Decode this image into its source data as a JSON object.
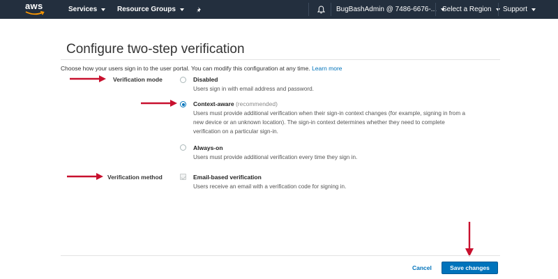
{
  "topnav": {
    "logo_text": "aws",
    "services": "Services",
    "resource_groups": "Resource Groups",
    "account": "BugBashAdmin @ 7486-6676-...",
    "region": "Select a Region",
    "support": "Support"
  },
  "page": {
    "title": "Configure two-step verification",
    "intro": "Choose how your users sign in to the user portal. You can modify this configuration at any time.",
    "learn_more": "Learn more"
  },
  "verification_mode": {
    "label": "Verification mode",
    "options": [
      {
        "title": "Disabled",
        "tag": "",
        "desc": [
          "Users sign in with email address and password."
        ],
        "selected": false
      },
      {
        "title": "Context-aware",
        "tag": "(recommended)",
        "desc": [
          "Users must provide additional verification when their sign-in context changes (for example, signing in from a",
          "new device or an unknown location). The sign-in context determines whether they need to complete",
          "verification on a particular sign-in."
        ],
        "selected": true
      },
      {
        "title": "Always-on",
        "tag": "",
        "desc": [
          "Users must provide additional verification every time they sign in."
        ],
        "selected": false
      }
    ]
  },
  "verification_method": {
    "label": "Verification method",
    "title": "Email-based verification",
    "desc": "Users receive an email with a verification code for signing in.",
    "checked": true,
    "disabled": true
  },
  "footer": {
    "cancel": "Cancel",
    "save": "Save changes"
  },
  "colors": {
    "nav_bg": "#232f3e",
    "accent": "#0073bb",
    "annotation_arrow": "#c8102e"
  }
}
